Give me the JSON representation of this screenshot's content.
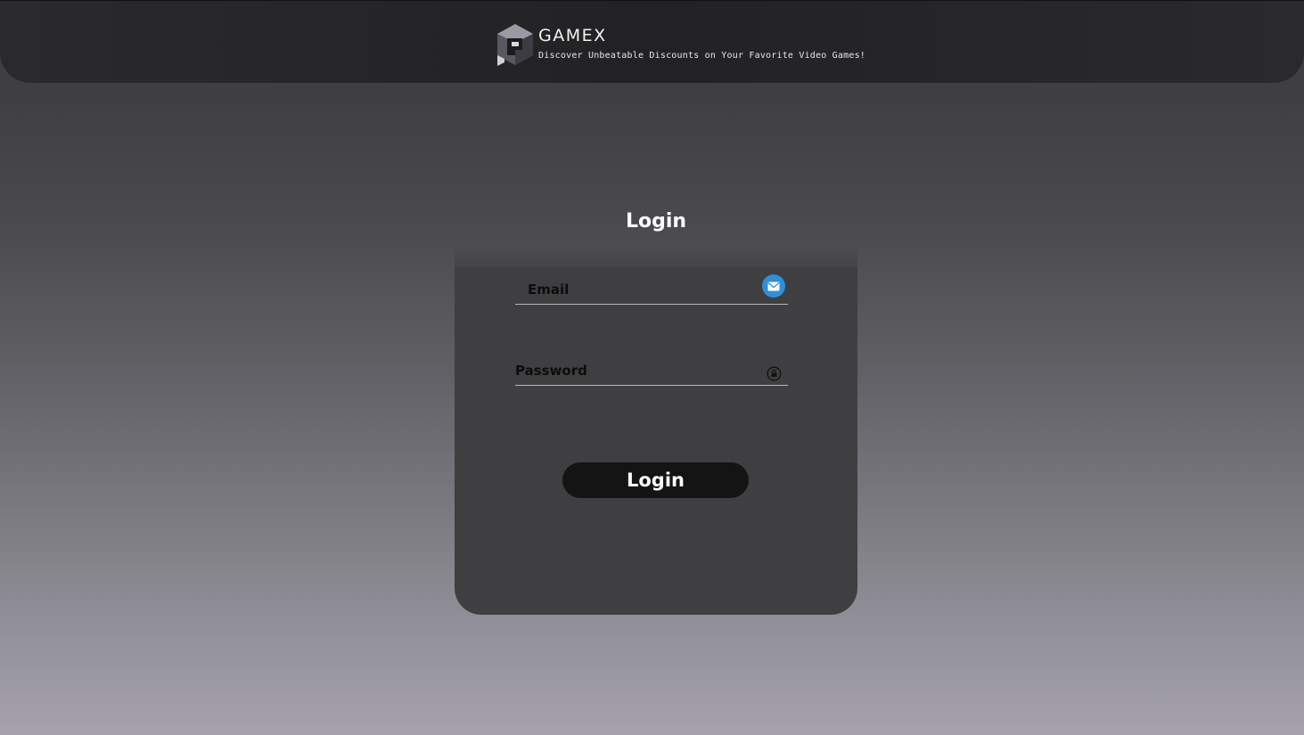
{
  "header": {
    "brand_name": "GAMEX",
    "tagline": "Discover Unbeatable Discounts on Your Favorite Video Games!",
    "logo_icon": "gamex-cube-logo"
  },
  "login_form": {
    "heading": "Login",
    "email": {
      "placeholder": "Email",
      "value": "",
      "icon": "envelope-icon"
    },
    "password": {
      "placeholder": "Password",
      "value": "",
      "icon": "lock-icon"
    },
    "submit_label": "Login"
  },
  "colors": {
    "header_bg": "#232325",
    "card_bg": "#3f3f41",
    "button_bg": "#141414",
    "email_icon_bg": "#2f8fd8",
    "text_light": "#ffffff"
  }
}
